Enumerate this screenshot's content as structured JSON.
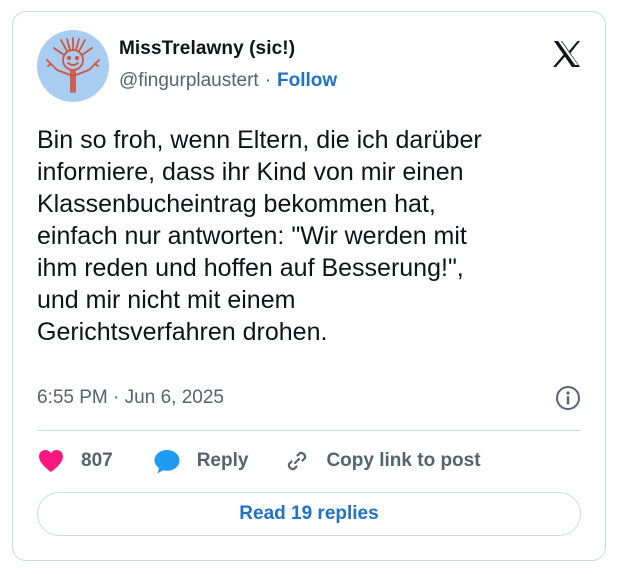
{
  "author": {
    "display_name": "MissTrelawny (sic!)",
    "handle": "@fingurplaustert",
    "separator": "·",
    "follow_label": "Follow"
  },
  "platform_logo": "x-logo-icon",
  "tweet": {
    "lines": [
      "Bin so froh, wenn Eltern, die ich  darüber",
      "informiere, dass ihr Kind von mir einen",
      "Klassenbucheintrag bekommen hat,",
      "einfach nur antworten: \"Wir werden mit",
      "ihm reden und hoffen auf Besserung!\",",
      "und mir nicht mit einem",
      "Gerichtsverfahren drohen."
    ],
    "time": "6:55 PM",
    "date_separator": "·",
    "date": "Jun 6, 2025"
  },
  "actions": {
    "like_count": "807",
    "reply_label": "Reply",
    "copy_label": "Copy link to post"
  },
  "read_replies_label": "Read 19 replies",
  "colors": {
    "accent": "#1d72c9",
    "like": "#f91880",
    "reply_icon": "#1d9bf0",
    "secondary_text": "#536471",
    "border": "#cfd9de",
    "avatar_bg": "#a9cdf0",
    "avatar_drawing": "#d2553f"
  }
}
